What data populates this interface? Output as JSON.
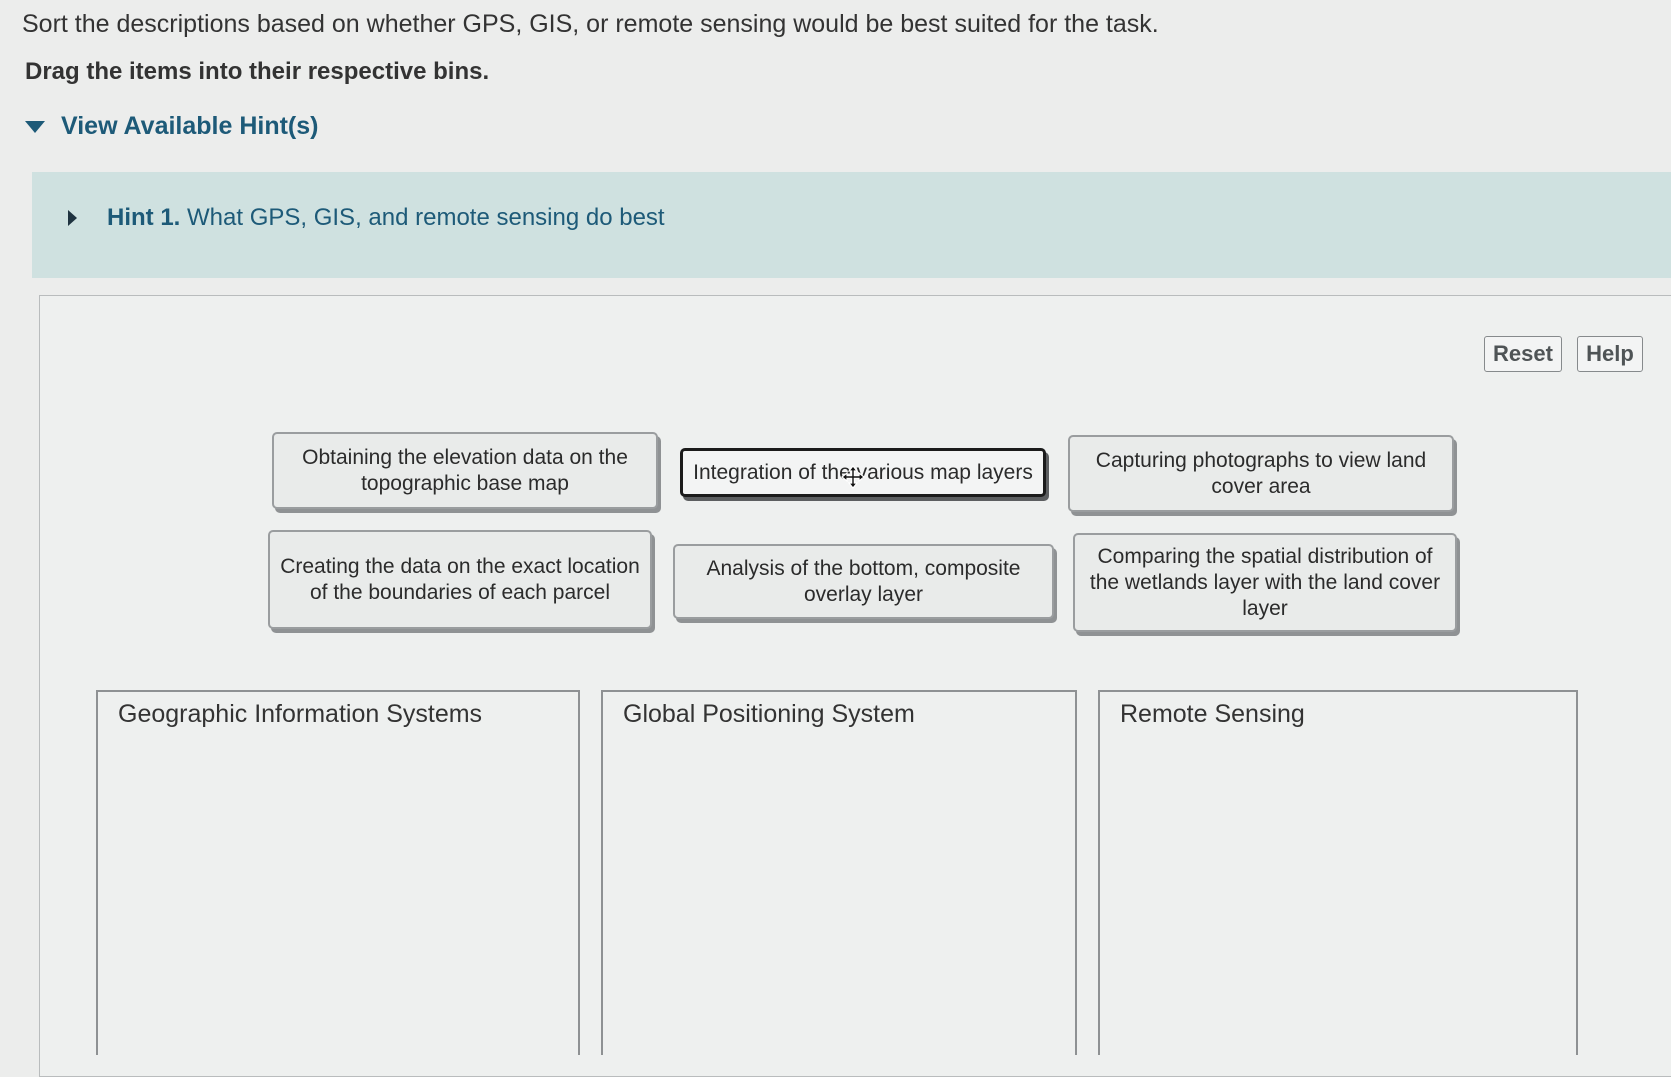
{
  "instructions": {
    "main": "Sort the descriptions based on whether GPS, GIS, or remote sensing would be best suited for the task.",
    "drag": "Drag the items into their respective bins."
  },
  "hints": {
    "toggle_label": "View Available Hint(s)",
    "items": [
      {
        "number": "Hint 1.",
        "text": "What GPS, GIS, and remote sensing do best"
      }
    ]
  },
  "toolbar": {
    "reset_label": "Reset",
    "help_label": "Help"
  },
  "items": [
    "Obtaining the elevation data on the topographic base map",
    "Integration of the various map layers",
    "Capturing photographs to view land cover area",
    "Creating the data on the exact location of the boundaries of each parcel",
    "Analysis of the bottom, composite overlay layer",
    "Comparing the spatial distribution of the wetlands layer with the land cover layer"
  ],
  "bins": [
    {
      "label": "Geographic Information Systems"
    },
    {
      "label": "Global Positioning System"
    },
    {
      "label": "Remote Sensing"
    }
  ],
  "icons": {
    "hints_toggle": "triangle-down-icon",
    "hint_expand": "triangle-right-icon",
    "cursor": "move-cursor-icon"
  },
  "colors": {
    "hint_link": "#1d5a78",
    "hint_panel_bg": "#cfe1e0",
    "page_bg": "#ecedec"
  }
}
